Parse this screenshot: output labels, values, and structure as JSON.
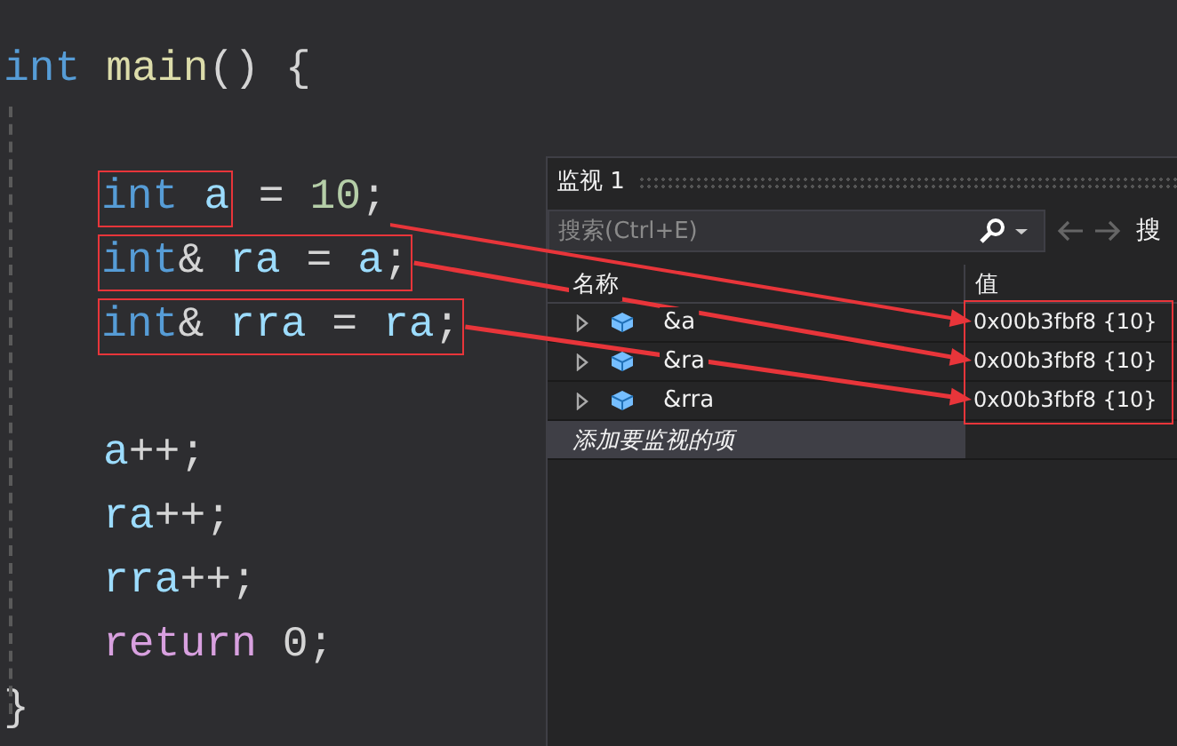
{
  "editor": {
    "signature": [
      {
        "text": "int",
        "kind": "keyword"
      },
      {
        "text": " main",
        "kind": "function"
      },
      {
        "text": "() {",
        "kind": "punct"
      }
    ],
    "declarations": [
      {
        "boxed": [
          {
            "text": "int",
            "kind": "keyword"
          },
          {
            "text": " a",
            "kind": "ident"
          }
        ],
        "rest": [
          {
            "text": " = ",
            "kind": "punct"
          },
          {
            "text": "10",
            "kind": "number"
          },
          {
            "text": ";",
            "kind": "punct"
          }
        ]
      },
      {
        "boxed": [
          {
            "text": "int",
            "kind": "keyword"
          },
          {
            "text": "& ",
            "kind": "punct"
          },
          {
            "text": "ra",
            "kind": "ident"
          },
          {
            "text": " = ",
            "kind": "punct"
          },
          {
            "text": "a",
            "kind": "ident"
          },
          {
            "text": ";",
            "kind": "punct"
          }
        ]
      },
      {
        "boxed": [
          {
            "text": "int",
            "kind": "keyword"
          },
          {
            "text": "& ",
            "kind": "punct"
          },
          {
            "text": "rra",
            "kind": "ident"
          },
          {
            "text": " = ",
            "kind": "punct"
          },
          {
            "text": "ra",
            "kind": "ident"
          },
          {
            "text": ";",
            "kind": "punct"
          }
        ]
      }
    ],
    "statements": [
      {
        "rest": [
          {
            "text": "a",
            "kind": "ident"
          },
          {
            "text": "++;",
            "kind": "punct"
          }
        ]
      },
      {
        "rest": [
          {
            "text": "ra",
            "kind": "ident"
          },
          {
            "text": "++;",
            "kind": "punct"
          }
        ]
      },
      {
        "rest": [
          {
            "text": "rra",
            "kind": "ident"
          },
          {
            "text": "++;",
            "kind": "punct"
          }
        ]
      },
      {
        "rest": [
          {
            "text": "return",
            "kind": "control"
          },
          {
            "text": " 0;",
            "kind": "punct"
          }
        ]
      }
    ],
    "closing": "}"
  },
  "watch": {
    "title": "监视 1",
    "search": {
      "placeholder": "搜索(Ctrl+E)"
    },
    "search_label": "搜",
    "columns": [
      "名称",
      "值"
    ],
    "rows": [
      {
        "name": "&a",
        "value": "0x00b3fbf8 {10}"
      },
      {
        "name": "&ra",
        "value": "0x00b3fbf8 {10}"
      },
      {
        "name": "&rra",
        "value": "0x00b3fbf8 {10}"
      }
    ],
    "add_item": "添加要监视的项",
    "values_boxed": true
  }
}
